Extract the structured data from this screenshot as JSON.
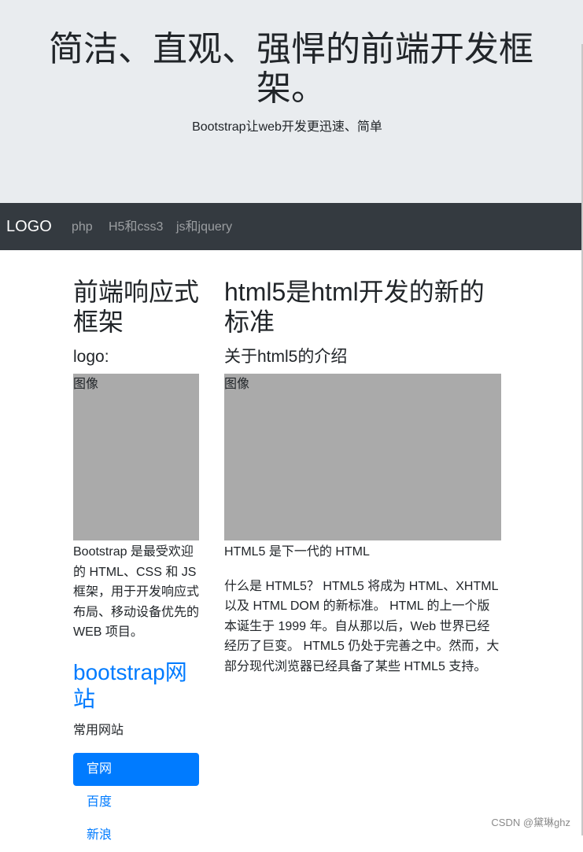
{
  "jumbotron": {
    "title": "简洁、直观、强悍的前端开发框架。",
    "subtitle": "Bootstrap让web开发更迅速、简单"
  },
  "navbar": {
    "brand": "LOGO",
    "links": [
      "php",
      "H5和css3",
      "js和jquery"
    ]
  },
  "sidebar": {
    "heading": "前端响应式框架",
    "subheading": "logo:",
    "image_label": "图像",
    "description": "Bootstrap 是最受欢迎的 HTML、CSS 和 JS 框架，用于开发响应式布局、移动设备优先的 WEB 项目。",
    "site_title": "bootstrap网站",
    "sites_caption": "常用网站",
    "nav_items": [
      "官网",
      "百度",
      "新浪"
    ]
  },
  "main": {
    "heading": "html5是html开发的新的标准",
    "subheading": "关于html5的介绍",
    "image_label": "图像",
    "caption": "HTML5 是下一代的 HTML",
    "body": "什么是 HTML5？ HTML5 将成为 HTML、XHTML 以及 HTML DOM 的新标准。 HTML 的上一个版本诞生于 1999 年。自从那以后，Web 世界已经经历了巨变。 HTML5 仍处于完善之中。然而，大部分现代浏览器已经具备了某些 HTML5 支持。"
  },
  "watermark": "CSDN @黛琳ghz",
  "colors": {
    "jumbotron_bg": "#e9ecef",
    "navbar_bg": "#343a40",
    "primary": "#007bff",
    "image_placeholder": "#aaaaaa"
  }
}
